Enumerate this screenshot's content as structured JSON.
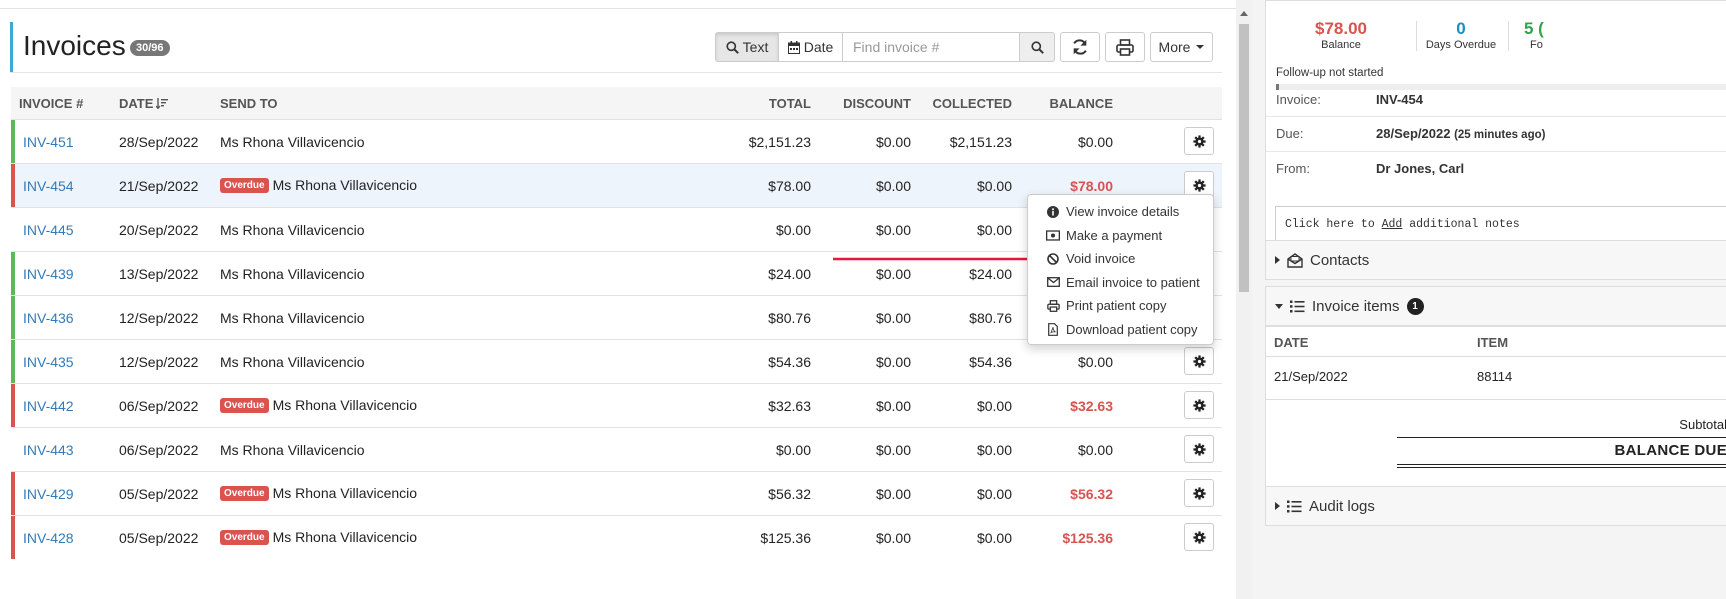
{
  "header": {
    "title": "Invoices",
    "count": "30/96",
    "text_button": "Text",
    "date_button": "Date",
    "search_placeholder": "Find invoice #",
    "more_button": "More"
  },
  "table": {
    "columns": {
      "invoice": "INVOICE #",
      "date": "DATE",
      "send_to": "SEND TO",
      "total": "TOTAL",
      "discount": "DISCOUNT",
      "collected": "COLLECTED",
      "balance": "BALANCE"
    },
    "overdue_label": "Overdue",
    "rows": [
      {
        "invoice": "INV-451",
        "date": "28/Sep/2022",
        "send_to": "Ms Rhona Villavicencio",
        "total": "$2,151.23",
        "discount": "$0.00",
        "collected": "$2,151.23",
        "balance": "$0.00",
        "overdue": false,
        "status": "paid"
      },
      {
        "invoice": "INV-454",
        "date": "21/Sep/2022",
        "send_to": "Ms Rhona Villavicencio",
        "total": "$78.00",
        "discount": "$0.00",
        "collected": "$0.00",
        "balance": "$78.00",
        "overdue": true,
        "status": "overdue"
      },
      {
        "invoice": "INV-445",
        "date": "20/Sep/2022",
        "send_to": "Ms Rhona Villavicencio",
        "total": "$0.00",
        "discount": "$0.00",
        "collected": "$0.00",
        "balance": "",
        "overdue": false,
        "status": "none"
      },
      {
        "invoice": "INV-439",
        "date": "13/Sep/2022",
        "send_to": "Ms Rhona Villavicencio",
        "total": "$24.00",
        "discount": "$0.00",
        "collected": "$24.00",
        "balance": "",
        "overdue": false,
        "status": "paid"
      },
      {
        "invoice": "INV-436",
        "date": "12/Sep/2022",
        "send_to": "Ms Rhona Villavicencio",
        "total": "$80.76",
        "discount": "$0.00",
        "collected": "$80.76",
        "balance": "",
        "overdue": false,
        "status": "paid"
      },
      {
        "invoice": "INV-435",
        "date": "12/Sep/2022",
        "send_to": "Ms Rhona Villavicencio",
        "total": "$54.36",
        "discount": "$0.00",
        "collected": "$54.36",
        "balance": "$0.00",
        "overdue": false,
        "status": "paid"
      },
      {
        "invoice": "INV-442",
        "date": "06/Sep/2022",
        "send_to": "Ms Rhona Villavicencio",
        "total": "$32.63",
        "discount": "$0.00",
        "collected": "$0.00",
        "balance": "$32.63",
        "overdue": true,
        "status": "overdue"
      },
      {
        "invoice": "INV-443",
        "date": "06/Sep/2022",
        "send_to": "Ms Rhona Villavicencio",
        "total": "$0.00",
        "discount": "$0.00",
        "collected": "$0.00",
        "balance": "$0.00",
        "overdue": false,
        "status": "none"
      },
      {
        "invoice": "INV-429",
        "date": "05/Sep/2022",
        "send_to": "Ms Rhona Villavicencio",
        "total": "$56.32",
        "discount": "$0.00",
        "collected": "$0.00",
        "balance": "$56.32",
        "overdue": true,
        "status": "overdue"
      },
      {
        "invoice": "INV-428",
        "date": "05/Sep/2022",
        "send_to": "Ms Rhona Villavicencio",
        "total": "$125.36",
        "discount": "$0.00",
        "collected": "$0.00",
        "balance": "$125.36",
        "overdue": true,
        "status": "overdue"
      }
    ]
  },
  "action_menu": {
    "items": [
      {
        "label": "View invoice details",
        "icon": "info-circle-icon"
      },
      {
        "label": "Make a payment",
        "icon": "money-icon"
      },
      {
        "label": "Void invoice",
        "icon": "ban-icon"
      },
      {
        "label": "Email invoice to patient",
        "icon": "envelope-icon"
      },
      {
        "label": "Print patient copy",
        "icon": "print-icon"
      },
      {
        "label": "Download patient copy",
        "icon": "file-pdf-icon"
      }
    ]
  },
  "detail": {
    "balance_value": "$78.00",
    "balance_label": "Balance",
    "days_overdue_value": "0",
    "days_overdue_label": "Days Overdue",
    "third_value": "5 (",
    "third_label": "Fo",
    "followup": "Follow-up not started",
    "followup_progress": 0.005,
    "invoice_label": "Invoice:",
    "invoice_value": "INV-454",
    "due_label": "Due:",
    "due_value": "28/Sep/2022",
    "due_note": "(25 minutes ago)",
    "from_label": "From:",
    "from_value": "Dr Jones, Carl",
    "notes_prefix": "Click here to ",
    "notes_link": "Add",
    "notes_suffix": " additional notes",
    "contacts_label": "Contacts",
    "items_label": "Invoice items",
    "items_count": "1",
    "items_columns": {
      "date": "DATE",
      "item": "ITEM"
    },
    "items_row": {
      "date": "21/Sep/2022",
      "item": "88114"
    },
    "subtotal_label": "Subtotal",
    "balance_due_label": "BALANCE DUE",
    "audit_label": "Audit logs"
  },
  "colors": {
    "accent": "#3fa9d6",
    "link": "#337ab7",
    "danger": "#d9534f",
    "success": "#5cb85c",
    "info": "#1a8fc9",
    "green": "#2ea44f"
  }
}
